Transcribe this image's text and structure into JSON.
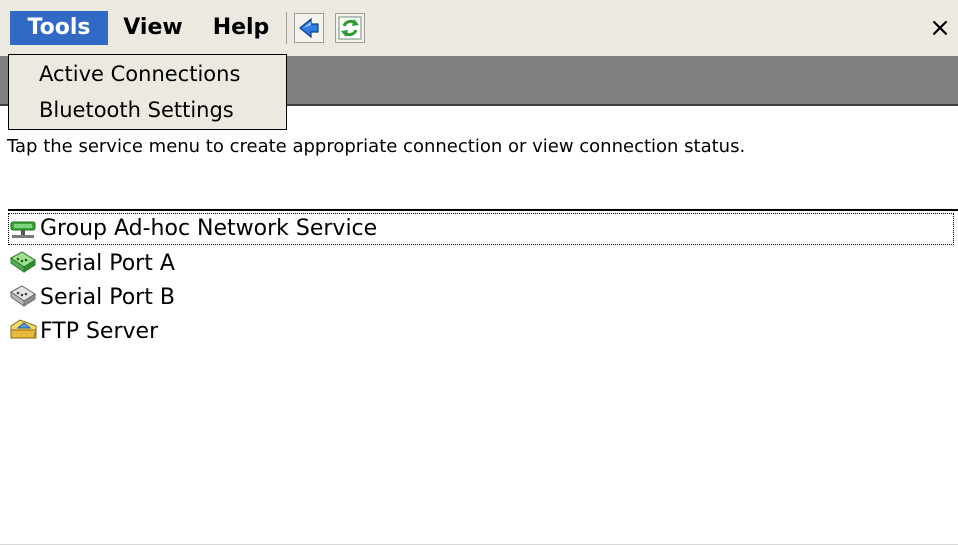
{
  "menubar": {
    "items": [
      {
        "label": "Tools"
      },
      {
        "label": "View"
      },
      {
        "label": "Help"
      }
    ],
    "close_label": "×"
  },
  "dropdown": {
    "items": [
      {
        "label": "Active Connections"
      },
      {
        "label": "Bluetooth Settings"
      }
    ]
  },
  "instruction": "Tap the service menu to create appropriate connection or view connection status.",
  "services": [
    {
      "label": "Group Ad-hoc Network Service",
      "icon": "network-icon"
    },
    {
      "label": "Serial Port A",
      "icon": "serial-port-active-icon"
    },
    {
      "label": "Serial Port B",
      "icon": "serial-port-inactive-icon"
    },
    {
      "label": "FTP Server",
      "icon": "ftp-folder-icon"
    }
  ],
  "colors": {
    "menu_highlight": "#316ac5",
    "title_strip": "#808080",
    "menubar_bg": "#ebe9e0"
  }
}
